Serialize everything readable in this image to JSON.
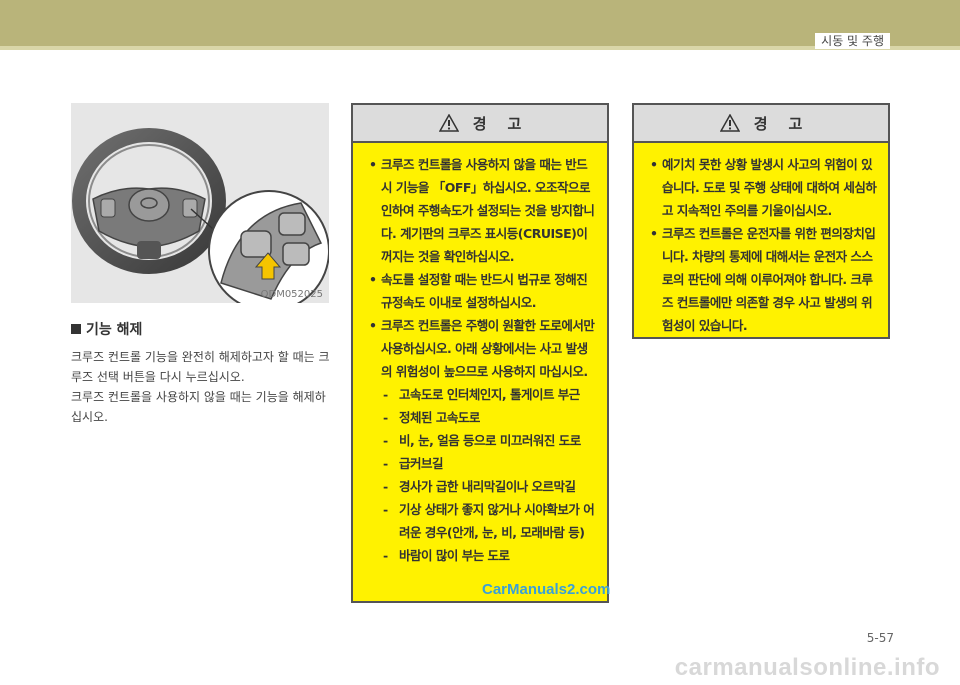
{
  "header": {
    "chapter_title": "시동 및 주행"
  },
  "figure": {
    "code": "ODM052025"
  },
  "section": {
    "heading": "기능 해제",
    "paragraphs": [
      "크루즈 컨트롤 기능을 완전히 해제하고자 할 때는 크루즈 선택 버튼을 다시 누르십시오.",
      "크루즈 컨트롤을 사용하지 않을 때는 기능을 해제하십시오."
    ]
  },
  "warning1": {
    "title": "경    고",
    "items": [
      "크루즈 컨트롤을 사용하지 않을 때는 반드시 기능을 「OFF」하십시오. 오조작으로 인하여 주행속도가 설정되는 것을 방지합니다. 계기판의 크루즈 표시등(CRUISE)이 꺼지는 것을 확인하십시오.",
      "속도를 설정할 때는 반드시 법규로 정해진 규정속도 이내로 설정하십시오.",
      "크루즈 컨트롤은 주행이 원활한 도로에서만 사용하십시오. 아래 상황에서는 사고 발생의 위험성이 높으므로 사용하지 마십시오."
    ],
    "sub_items": [
      "고속도로 인터체인지, 톨게이트 부근",
      "정체된 고속도로",
      "비, 눈, 얼음 등으로 미끄러워진 도로",
      "급커브길",
      "경사가 급한 내리막길이나 오르막길",
      "기상 상태가 좋지 않거나 시야확보가 어려운 경우(안개, 눈, 비, 모래바람 등)",
      "바람이 많이 부는 도로"
    ]
  },
  "warning2": {
    "title": "경    고",
    "items": [
      "예기치 못한 상황 발생시 사고의 위험이 있습니다. 도로 및 주행 상태에 대하여 세심하고 지속적인 주의를 기울이십시오.",
      "크루즈 컨트롤은 운전자를 위한 편의장치입니다. 차량의 통제에 대해서는 운전자 스스로의 판단에 의해 이루어져야 합니다. 크루즈 컨트롤에만 의존할 경우 사고 발생의 위험성이 있습니다."
    ]
  },
  "page_number": "5-57",
  "watermark": "CarManuals2.com",
  "footer_mark": "carmanualsonline.info",
  "colors": {
    "header": "#b9b47a",
    "warning_bg": "#fff200",
    "warning_head": "#dcdcdc"
  }
}
